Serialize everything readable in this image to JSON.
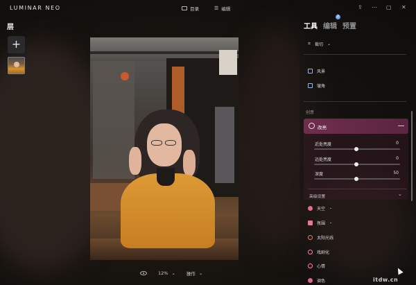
{
  "app": {
    "name": "LUMINAR NEO"
  },
  "header": {
    "nav": [
      {
        "label": "目录"
      },
      {
        "label": "编辑"
      }
    ]
  },
  "layers": {
    "title": "层",
    "add": "+"
  },
  "bottom": {
    "zoom": "12%",
    "actions": "操作"
  },
  "panel": {
    "tabs": [
      {
        "label": "工具"
      },
      {
        "label": "编辑"
      },
      {
        "label": "预置"
      }
    ],
    "badge": "2",
    "crop": "裁切",
    "items_top": [
      {
        "label": "风景"
      },
      {
        "label": "皱角"
      }
    ],
    "section": "创意",
    "active_tool": {
      "label": "改亮",
      "sliders": [
        {
          "label": "近处亮度",
          "value": "0",
          "pos": 0.5
        },
        {
          "label": "远处亮度",
          "value": "0",
          "pos": 0.5
        },
        {
          "label": "深度",
          "value": "50",
          "pos": 0.5
        }
      ],
      "advanced": "高级设置"
    },
    "tools": [
      {
        "label": "天空"
      },
      {
        "label": "氛围"
      },
      {
        "label": "太阳光线"
      },
      {
        "label": "戏剧化"
      },
      {
        "label": "心情"
      },
      {
        "label": "调色"
      }
    ]
  },
  "watermark": "itdw.cn",
  "colors": {
    "accent": "#6e2e4d",
    "badge": "#6da7f0"
  }
}
